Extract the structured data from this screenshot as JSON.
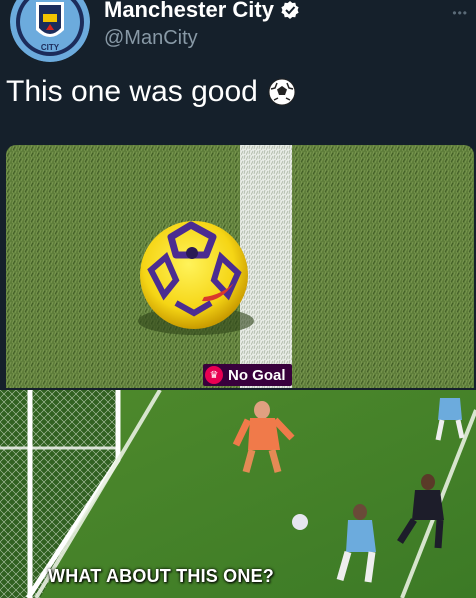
{
  "tweet": {
    "account_name": "Manchester City",
    "handle": "@ManCity",
    "text": "This one was good",
    "verified_icon": "verified-badge-icon",
    "emoji_icon": "soccer-ball-icon",
    "avatar_text": "CITY"
  },
  "image_one": {
    "badge_text": "No Goal",
    "badge_icon": "premier-league-logo-icon"
  },
  "image_two": {
    "caption": "WHAT ABOUT THIS ONE?"
  },
  "colors": {
    "background": "#15202b",
    "text": "#ffffff",
    "secondary_text": "#8899a6",
    "badge_bg": "#38003c",
    "ball_yellow": "#f5d515",
    "ball_purple": "#4b2c91",
    "pitch_green": "#5e7d3a"
  }
}
